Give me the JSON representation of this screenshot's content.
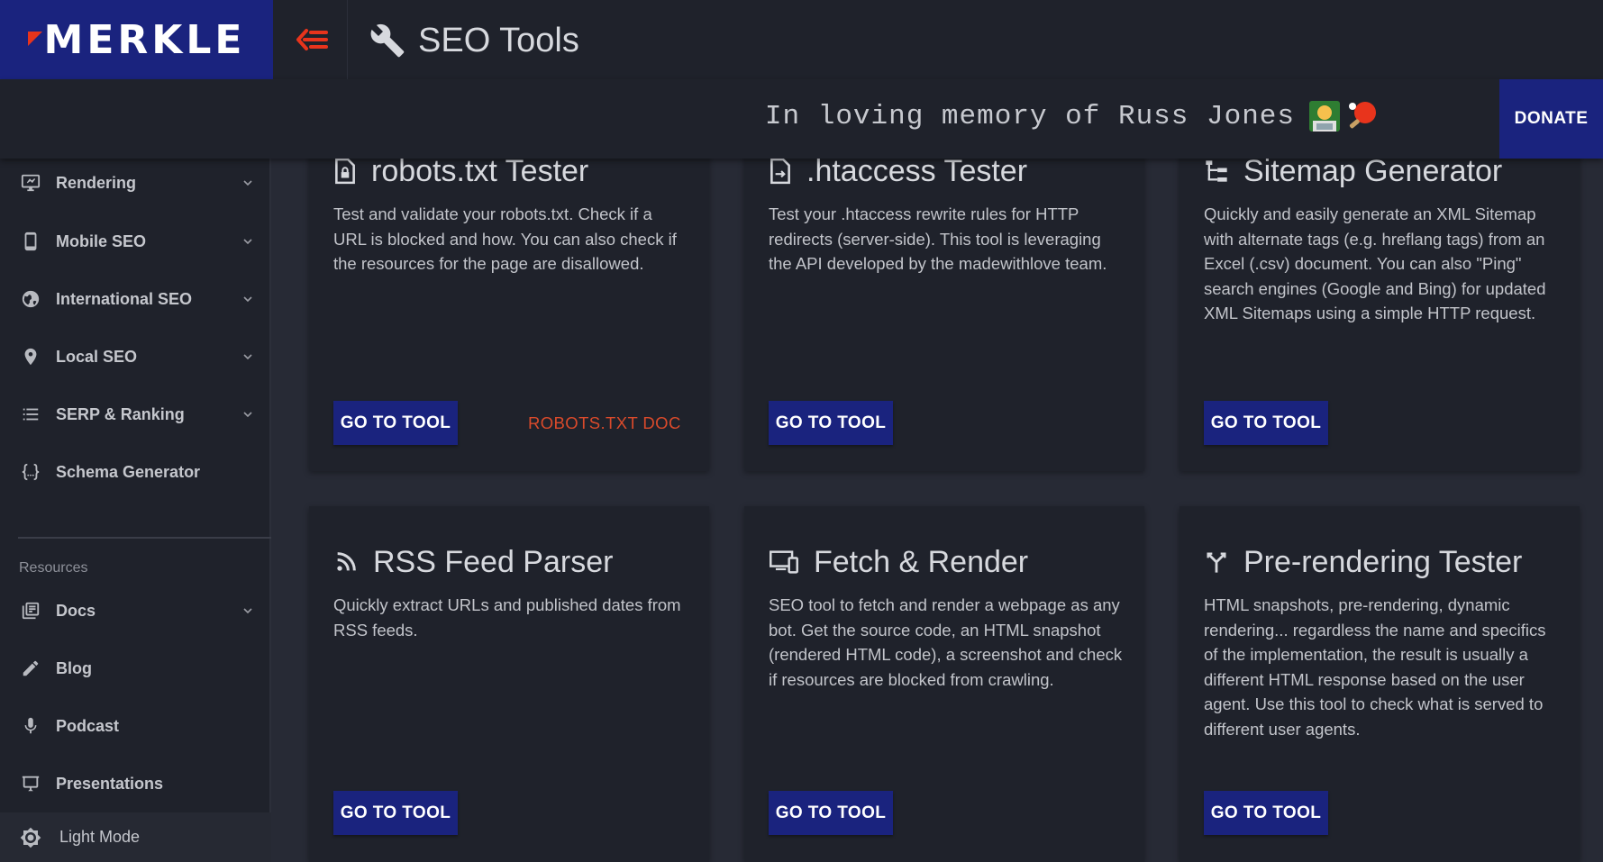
{
  "header": {
    "logo": "MERKLE",
    "title": "SEO Tools",
    "memory_text": "In loving memory of Russ Jones",
    "donate_label": "DONATE"
  },
  "colors": {
    "accent": "#1a237e",
    "orange": "#e8341c",
    "background": "#272a35",
    "panel": "#1f222b"
  },
  "sidebar": {
    "items": [
      {
        "label": "Rendering",
        "icon": "monitor-icon",
        "chevron": true
      },
      {
        "label": "Mobile SEO",
        "icon": "phone-icon",
        "chevron": true
      },
      {
        "label": "International SEO",
        "icon": "globe-icon",
        "chevron": true
      },
      {
        "label": "Local SEO",
        "icon": "location-pin-icon",
        "chevron": true
      },
      {
        "label": "SERP & Ranking",
        "icon": "list-icon",
        "chevron": true
      },
      {
        "label": "Schema Generator",
        "icon": "braces-icon",
        "chevron": false
      }
    ],
    "resources_label": "Resources",
    "resources": [
      {
        "label": "Docs",
        "icon": "library-icon",
        "chevron": true
      },
      {
        "label": "Blog",
        "icon": "pencil-icon",
        "chevron": false
      },
      {
        "label": "Podcast",
        "icon": "microphone-icon",
        "chevron": false
      },
      {
        "label": "Presentations",
        "icon": "presentation-icon",
        "chevron": false
      }
    ],
    "light_mode_label": "Light Mode"
  },
  "cards": [
    {
      "title": "robots.txt Tester",
      "icon": "file-lock-icon",
      "description": "Test and validate your robots.txt. Check if a URL is blocked and how. You can also check if the resources for the page are disallowed.",
      "button": "GO TO TOOL",
      "link": "ROBOTS.TXT DOC"
    },
    {
      "title": ".htaccess Tester",
      "icon": "file-redirect-icon",
      "description": "Test your .htaccess rewrite rules for HTTP redirects (server-side). This tool is leveraging the API developed by the madewithlove team.",
      "button": "GO TO TOOL"
    },
    {
      "title": "Sitemap Generator",
      "icon": "sitemap-icon",
      "description": "Quickly and easily generate an XML Sitemap with alternate tags (e.g. hreflang tags) from an Excel (.csv) document. You can also \"Ping\" search engines (Google and Bing) for updated XML Sitemaps using a simple HTTP request.",
      "button": "GO TO TOOL"
    },
    {
      "title": "RSS Feed Parser",
      "icon": "rss-icon",
      "description": "Quickly extract URLs and published dates from RSS feeds.",
      "button": "GO TO TOOL"
    },
    {
      "title": "Fetch & Render",
      "icon": "devices-icon",
      "description": "SEO tool to fetch and render a webpage as any bot. Get the source code, an HTML snapshot (rendered HTML code), a screenshot and check if resources are blocked from crawling.",
      "button": "GO TO TOOL"
    },
    {
      "title": "Pre-rendering Tester",
      "icon": "merge-icon",
      "description": "HTML snapshots, pre-rendering, dynamic rendering... regardless the name and specifics of the implementation, the result is usually a different HTML response based on the user agent. Use this tool to check what is served to different user agents.",
      "button": "GO TO TOOL"
    }
  ]
}
